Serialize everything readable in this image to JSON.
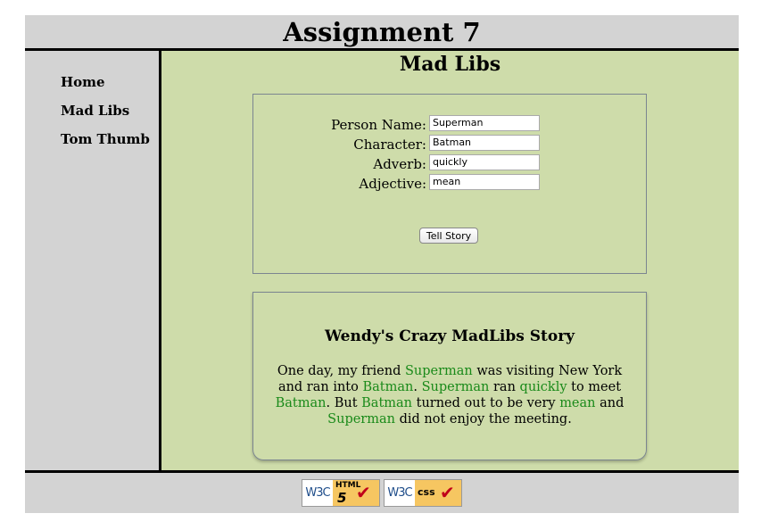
{
  "header": {
    "title": "Assignment 7"
  },
  "sidebar": {
    "items": [
      {
        "label": "Home"
      },
      {
        "label": "Mad Libs"
      },
      {
        "label": "Tom Thumb"
      }
    ]
  },
  "main": {
    "title": "Mad Libs"
  },
  "form": {
    "person_name": {
      "label": "Person Name:",
      "value": "Superman"
    },
    "character": {
      "label": "Character:",
      "value": "Batman"
    },
    "adverb": {
      "label": "Adverb:",
      "value": "quickly"
    },
    "adjective": {
      "label": "Adjective:",
      "value": "mean"
    },
    "submit_label": "Tell Story"
  },
  "story": {
    "title": "Wendy's Crazy MadLibs Story",
    "parts": {
      "p1": "One day, my friend ",
      "w1": "Superman",
      "p2": " was visiting New York and ran into ",
      "w2": "Batman",
      "p3": ". ",
      "w3": "Superman",
      "p4": " ran ",
      "w4": "quickly",
      "p5": " to meet ",
      "w5": "Batman",
      "p6": ". But ",
      "w6": "Batman",
      "p7": " turned out to be very ",
      "w7": "mean",
      "p8": " and ",
      "w8": "Superman",
      "p9": " did not enjoy the meeting."
    },
    "highlight_color": "#1a8a1a"
  },
  "footer": {
    "badges": [
      {
        "w3c": "W3C",
        "label_top": "HTML",
        "label_bottom": "5",
        "icon": "checkmark-icon"
      },
      {
        "w3c": "W3C",
        "label": "css",
        "icon": "checkmark-icon"
      }
    ]
  },
  "colors": {
    "page_frame": "#d3d3d3",
    "main_background": "#cedcaa",
    "rules": "#000000"
  }
}
